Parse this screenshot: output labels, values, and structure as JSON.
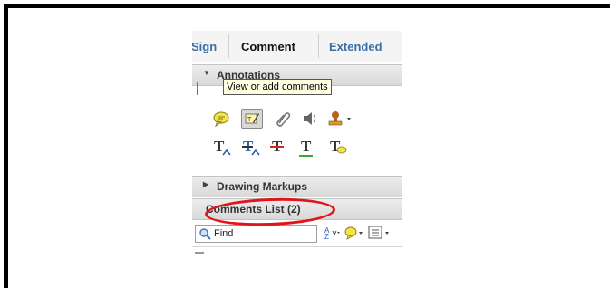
{
  "tabs": [
    {
      "label": "Sign"
    },
    {
      "label": "Comment"
    },
    {
      "label": "Extended"
    }
  ],
  "annotations": {
    "header": "Annotations",
    "tooltip": "View or add comments",
    "tools_row1": [
      "sticky-note-icon",
      "highlight-text-icon",
      "attach-file-icon",
      "record-audio-icon",
      "add-stamp-icon"
    ],
    "tools_row2": [
      "insert-text-icon",
      "replace-text-icon",
      "strikethrough-icon",
      "underline-icon",
      "add-note-to-text-icon"
    ]
  },
  "drawing_markups": {
    "header": "Drawing Markups"
  },
  "comments_list": {
    "header": "Comments List (2)"
  },
  "search": {
    "value": "Find"
  },
  "colors": {
    "accent_tab": "#3a6ea5",
    "highlight_oval": "#e0141a",
    "tooltip_bg": "#ffffe1"
  }
}
